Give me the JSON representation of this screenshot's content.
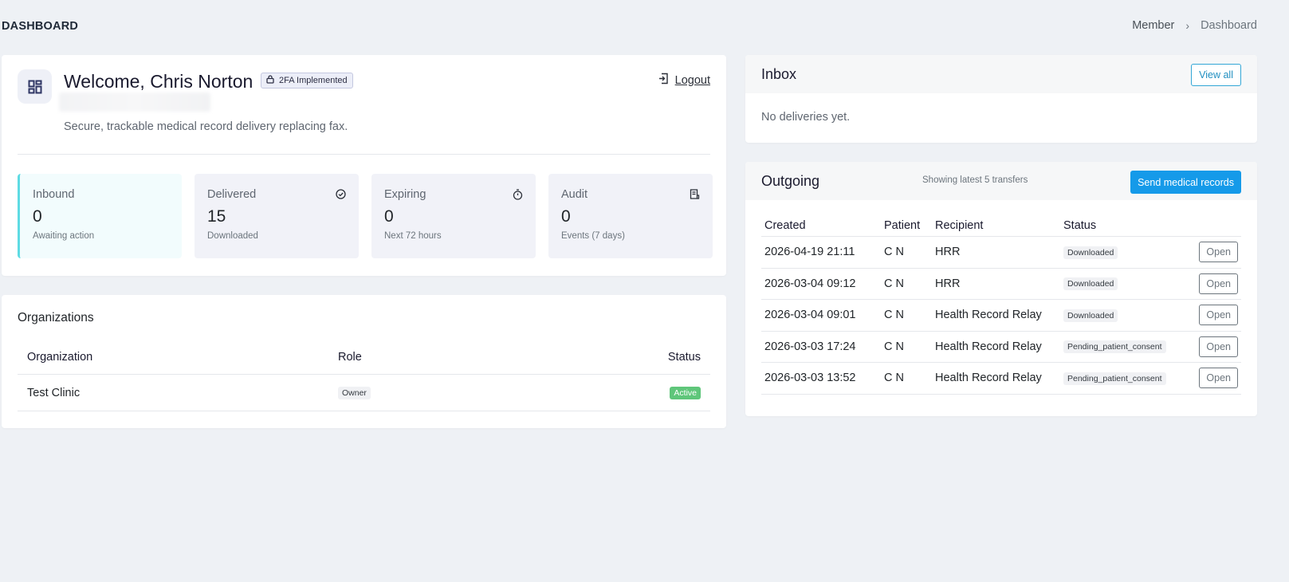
{
  "header": {
    "title": "DASHBOARD",
    "breadcrumb": [
      "Member",
      "Dashboard"
    ]
  },
  "welcome": {
    "title": "Welcome, Chris Norton",
    "badge": "2FA Implemented",
    "tagline": "Secure, trackable medical record delivery replacing fax.",
    "logout_label": "Logout"
  },
  "stats": [
    {
      "label": "Inbound",
      "value": "0",
      "sub": "Awaiting action",
      "icon": "none"
    },
    {
      "label": "Delivered",
      "value": "15",
      "sub": "Downloaded",
      "icon": "check-circle-icon"
    },
    {
      "label": "Expiring",
      "value": "0",
      "sub": "Next 72 hours",
      "icon": "stopwatch-icon"
    },
    {
      "label": "Audit",
      "value": "0",
      "sub": "Events (7 days)",
      "icon": "receipt-icon"
    }
  ],
  "organizations": {
    "title": "Organizations",
    "headers": [
      "Organization",
      "Role",
      "Status"
    ],
    "rows": [
      {
        "name": "Test Clinic",
        "role": "Owner",
        "status": "Active"
      }
    ]
  },
  "inbox": {
    "title": "Inbox",
    "view_all": "View all",
    "empty": "No deliveries yet."
  },
  "outgoing": {
    "title": "Outgoing",
    "showing": "Showing latest 5 transfers",
    "send_label": "Send medical records",
    "headers": [
      "Created",
      "Patient",
      "Recipient",
      "Status"
    ],
    "open_label": "Open",
    "rows": [
      {
        "created": "2026-04-19 21:11",
        "patient": "C N",
        "recipient": "HRR",
        "status": "Downloaded"
      },
      {
        "created": "2026-03-04 09:12",
        "patient": "C N",
        "recipient": "HRR",
        "status": "Downloaded"
      },
      {
        "created": "2026-03-04 09:01",
        "patient": "C N",
        "recipient": "Health Record Relay",
        "status": "Downloaded"
      },
      {
        "created": "2026-03-03 17:24",
        "patient": "C N",
        "recipient": "Health Record Relay",
        "status": "Pending_patient_consent"
      },
      {
        "created": "2026-03-03 13:52",
        "patient": "C N",
        "recipient": "Health Record Relay",
        "status": "Pending_patient_consent"
      }
    ]
  },
  "colors": {
    "accent": "#159ae9",
    "inbound_border": "#5edbe3",
    "active_badge": "#5fc67a"
  }
}
